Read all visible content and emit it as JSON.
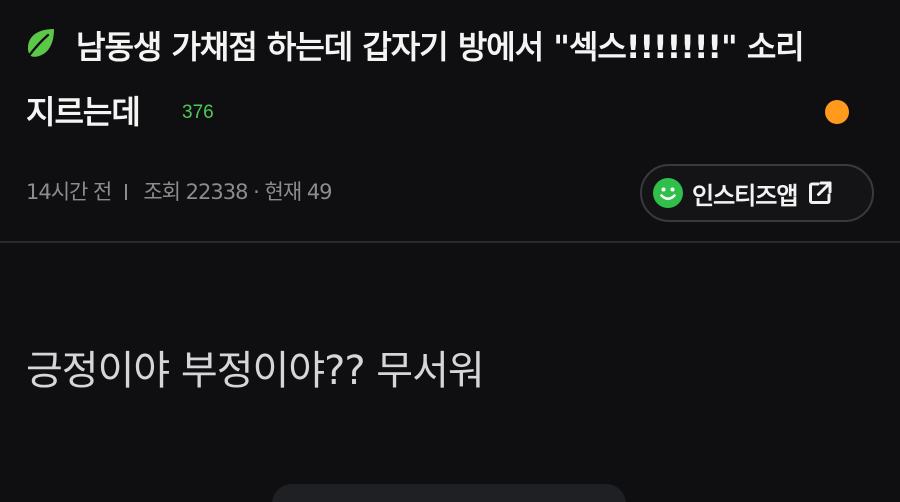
{
  "post": {
    "category_icon": "leaf-icon",
    "title_line1": "남동생 가채점 하는데 갑자기 방에서 \"섹스!!!!!!!\" 소리",
    "title_line2": "지르는데",
    "comment_count": "376",
    "status_dot_color": "#ff9a1c"
  },
  "meta": {
    "time": "14시간 전",
    "views": "조회 22338 · 현재 49"
  },
  "app_button": {
    "icon": "smiley-icon",
    "label": "인스티즈앱",
    "external_icon": "external-link-icon"
  },
  "body": {
    "text": "긍정이야 부정이야?? 무서워"
  },
  "colors": {
    "background": "#0f0f11",
    "accent_green": "#4cc95a",
    "status_orange": "#ff9a1c"
  }
}
